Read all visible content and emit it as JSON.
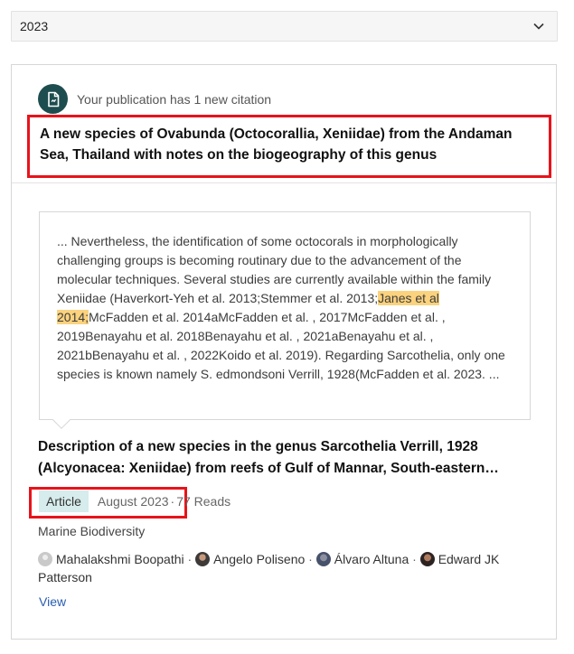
{
  "year_filter": {
    "selected": "2023"
  },
  "notification": {
    "text": "Your publication has 1 new citation",
    "icon": "document-icon",
    "publication_title": "A new species of Ovabunda (Octocorallia, Xeniidae) from the Andaman Sea, Thailand with notes on the biogeography of this genus"
  },
  "quote": {
    "before": "... Nevertheless, the identification of some octocorals in morphologically challenging groups is becoming routinary due to the advancement of the molecular techniques. Several studies are currently available within the family Xeniidae (Haverkort-Yeh et al. 2013;Stemmer et al. 2013;",
    "highlight": "Janes et al 2014;",
    "after": "McFadden et al. 2014aMcFadden et al. , 2017McFadden et al. , 2019Benayahu et al. 2018Benayahu et al. , 2021aBenayahu et al. , 2021bBenayahu et al. , 2022Koido et al. 2019). Regarding Sarcothelia, only one species is known namely S. edmondsoni Verrill, 1928(McFadden et al. 2023. ..."
  },
  "article": {
    "title": "Description of a new species in the genus Sarcothelia Verrill, 1928 (Alcyonacea: Xeniidae) from reefs of Gulf of Mannar, South-eastern…",
    "type": "Article",
    "date": "August 2023",
    "separator": "·",
    "reads": "77 Reads",
    "journal": "Marine Biodiversity",
    "authors": [
      {
        "name": "Mahalakshmi Boopathi"
      },
      {
        "name": "Angelo Poliseno"
      },
      {
        "name": "Álvaro Altuna"
      },
      {
        "name": "Edward JK Patterson"
      }
    ],
    "author_separator": " · ",
    "view_label": "View"
  },
  "colors": {
    "highlight": "#fbd27d",
    "badge_bg": "#d7ecec",
    "icon_bg": "#1e4d4f",
    "link": "#2a5db0",
    "annotation_box": "#e8131b"
  }
}
